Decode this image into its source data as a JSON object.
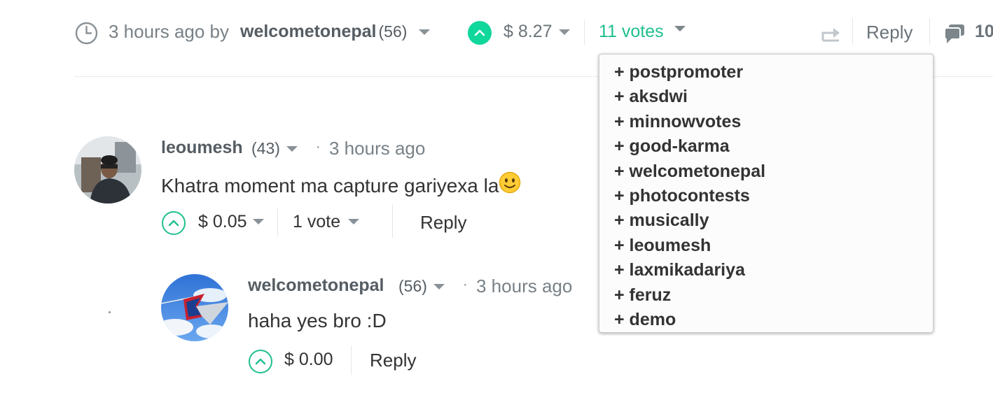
{
  "post_meta": {
    "time_text": "3 hours ago by",
    "author": "welcometonepal",
    "reputation": "(56)",
    "payout": "$ 8.27",
    "votes": "11 votes",
    "reply": "Reply",
    "comments_count": "10"
  },
  "voters": [
    "+ postpromoter",
    "+ aksdwi",
    "+ minnowvotes",
    "+ good-karma",
    "+ welcometonepal",
    "+ photocontests",
    "+ musically",
    "+ leoumesh",
    "+ laxmikadariya",
    "+ feruz",
    "+ demo"
  ],
  "comments": [
    {
      "author": "leoumesh",
      "reputation": "(43)",
      "time": "3 hours ago",
      "body": "Khatra moment ma capture gariyexa la",
      "payout": "$ 0.05",
      "votes": "1 vote",
      "reply": "Reply"
    },
    {
      "author": "welcometonepal",
      "reputation": "(56)",
      "time": "3 hours ago",
      "body": "haha yes bro :D",
      "payout": "$ 0.00",
      "reply": "Reply"
    }
  ],
  "icons": {
    "clock": "clock-icon",
    "upvote": "upvote-icon",
    "reblog": "reblog-icon",
    "comments": "comments-icon",
    "smiley": "smiley-emoji-icon"
  },
  "colors": {
    "accent_green": "#1fbf8f",
    "text_muted": "#788187",
    "text_dark": "#333333"
  }
}
